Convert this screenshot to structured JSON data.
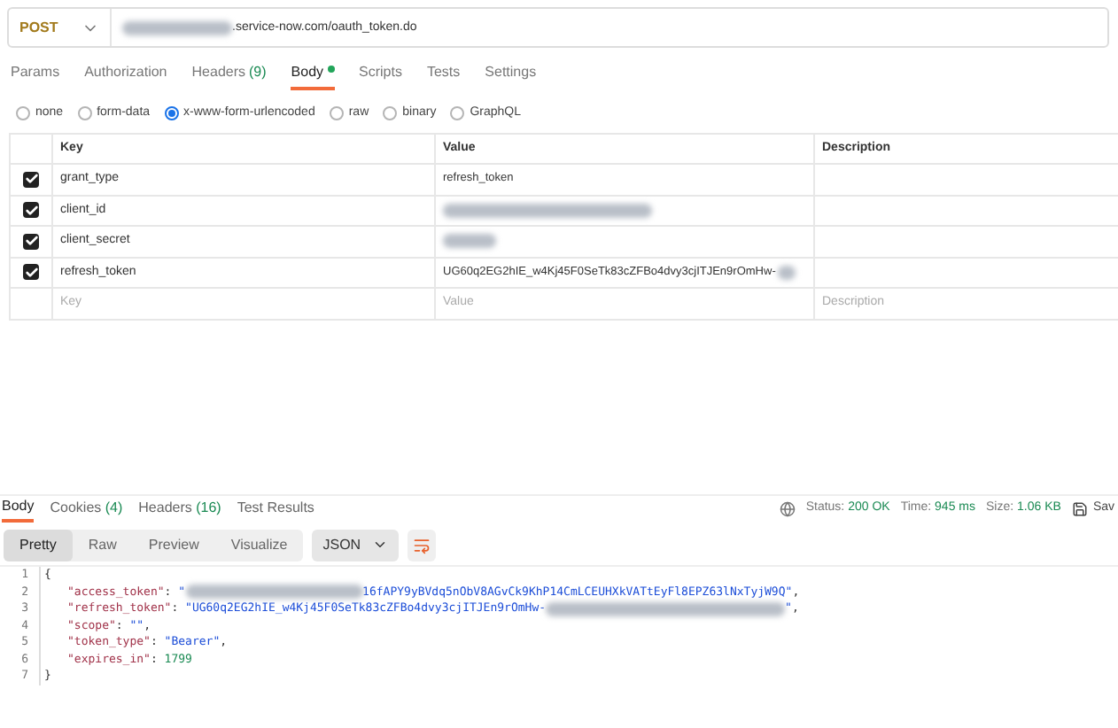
{
  "request": {
    "method": "POST",
    "url_tail": ".service-now.com/oauth_token.do"
  },
  "request_tabs": [
    {
      "label": "Params",
      "selected": false
    },
    {
      "label": "Authorization",
      "selected": false
    },
    {
      "label": "Headers",
      "count": "(9)",
      "selected": false
    },
    {
      "label": "Body",
      "dot": true,
      "selected": true
    },
    {
      "label": "Scripts",
      "selected": false
    },
    {
      "label": "Tests",
      "selected": false
    },
    {
      "label": "Settings",
      "selected": false
    }
  ],
  "body_types": [
    {
      "label": "none",
      "selected": false
    },
    {
      "label": "form-data",
      "selected": false
    },
    {
      "label": "x-www-form-urlencoded",
      "selected": true
    },
    {
      "label": "raw",
      "selected": false
    },
    {
      "label": "binary",
      "selected": false
    },
    {
      "label": "GraphQL",
      "selected": false
    }
  ],
  "table": {
    "columns": [
      "Key",
      "Value",
      "Description"
    ],
    "rows": [
      {
        "checked": true,
        "key": "grant_type",
        "value": "refresh_token",
        "redacted": false
      },
      {
        "checked": true,
        "key": "client_id",
        "redacted": true
      },
      {
        "checked": true,
        "key": "client_secret",
        "redacted": true
      },
      {
        "checked": true,
        "key": "refresh_token",
        "value": "UG60q2EG2hIE_w4Kj45F0SeTk83cZFBo4dvy3cjITJEn9rOmHw-",
        "redacted": true
      }
    ],
    "new_row": {
      "key": {
        "placeholder": "Key"
      },
      "value": {
        "placeholder": "Value"
      },
      "description": {
        "placeholder": "Description"
      }
    }
  },
  "response_tabs": [
    {
      "label": "Body",
      "selected": true
    },
    {
      "label": "Cookies",
      "count": "(4)",
      "selected": false
    },
    {
      "label": "Headers",
      "count": "(16)",
      "selected": false
    },
    {
      "label": "Test Results",
      "selected": false
    }
  ],
  "status": {
    "status_label": "Status:",
    "status": "200 OK",
    "time_label": "Time:",
    "time": "945 ms",
    "size_label": "Size:",
    "size": "1.06 KB",
    "save": "Sav"
  },
  "view_tabs": [
    {
      "label": "Pretty",
      "selected": true
    },
    {
      "label": "Raw",
      "selected": false
    },
    {
      "label": "Preview",
      "selected": false
    },
    {
      "label": "Visualize",
      "selected": false
    }
  ],
  "format": "JSON",
  "code_lines": [
    {
      "number": "1",
      "tokens": [
        {
          "kind": "punct",
          "text": "{"
        }
      ]
    },
    {
      "number": "2",
      "tokens": [
        {
          "kind": "key",
          "text": "\"access_token\""
        },
        {
          "kind": "punct",
          "text": ": "
        },
        {
          "kind": "string",
          "text": "\""
        },
        {
          "kind": "redacted"
        },
        {
          "kind": "string",
          "text": "16fAPY9yBVdq5nObV8AGvCk9KhP14CmLCEUHXkVATtEyFl8EPZ63lNxTyjW9Q\""
        },
        {
          "kind": "punct",
          "text": ","
        }
      ]
    },
    {
      "number": "3",
      "tokens": [
        {
          "kind": "key",
          "text": "\"refresh_token\""
        },
        {
          "kind": "punct",
          "text": ": "
        },
        {
          "kind": "string",
          "text": "\"UG60q2EG2hIE_w4Kj45F0SeTk83cZFBo4dvy3cjITJEn9rOmHw-"
        },
        {
          "kind": "redacted"
        },
        {
          "kind": "string",
          "text": "\""
        },
        {
          "kind": "punct",
          "text": ","
        }
      ]
    },
    {
      "number": "4",
      "tokens": [
        {
          "kind": "key",
          "text": "\"scope\""
        },
        {
          "kind": "punct",
          "text": ": "
        },
        {
          "kind": "string",
          "text": "\"\""
        },
        {
          "kind": "punct",
          "text": ","
        }
      ]
    },
    {
      "number": "5",
      "tokens": [
        {
          "kind": "key",
          "text": "\"token_type\""
        },
        {
          "kind": "punct",
          "text": ": "
        },
        {
          "kind": "string",
          "text": "\"Bearer\""
        },
        {
          "kind": "punct",
          "text": ","
        }
      ]
    },
    {
      "number": "6",
      "tokens": [
        {
          "kind": "key",
          "text": "\"expires_in\""
        },
        {
          "kind": "punct",
          "text": ": "
        },
        {
          "kind": "number",
          "text": "1799"
        }
      ]
    },
    {
      "number": "7",
      "tokens": [
        {
          "kind": "punct",
          "text": "}"
        }
      ]
    }
  ]
}
